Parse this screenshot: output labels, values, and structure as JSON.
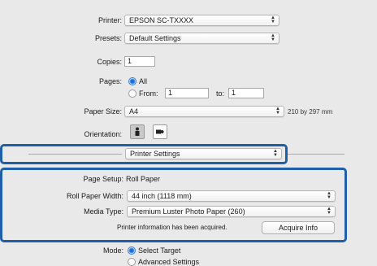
{
  "printer": {
    "label": "Printer:",
    "value": "EPSON SC-TXXXX"
  },
  "presets": {
    "label": "Presets:",
    "value": "Default Settings"
  },
  "copies": {
    "label": "Copies:",
    "value": "1"
  },
  "pages": {
    "label": "Pages:",
    "all_label": "All",
    "from_label": "From:",
    "from_value": "1",
    "to_label": "to:",
    "to_value": "1"
  },
  "paper_size": {
    "label": "Paper Size:",
    "value": "A4",
    "dimensions": "210 by 297 mm"
  },
  "orientation": {
    "label": "Orientation:"
  },
  "panel_selector": {
    "value": "Printer Settings"
  },
  "page_setup": {
    "label": "Page Setup:",
    "value": "Roll Paper"
  },
  "roll_paper_width": {
    "label": "Roll Paper Width:",
    "value": "44 inch (1118 mm)"
  },
  "media_type": {
    "label": "Media Type:",
    "value": "Premium Luster Photo Paper (260)"
  },
  "printer_info": {
    "status": "Printer information has been acquired.",
    "button": "Acquire Info"
  },
  "mode": {
    "label": "Mode:",
    "option1": "Select Target",
    "option2": "Advanced Settings"
  },
  "colors": {
    "highlight": "#1f5faa",
    "radio_selected": "#1d6fd8"
  }
}
